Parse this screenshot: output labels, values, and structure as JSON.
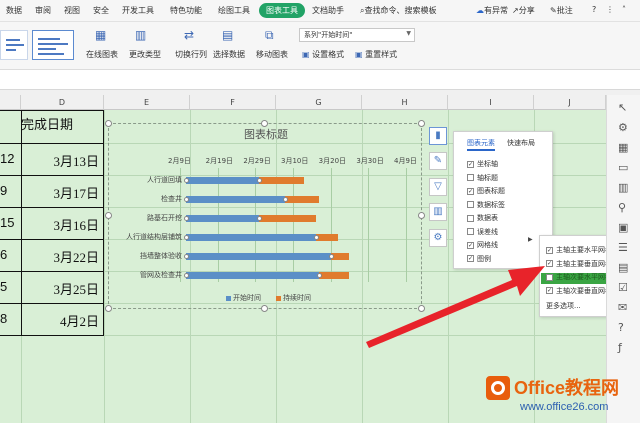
{
  "menu": {
    "items": [
      "数据",
      "审阅",
      "视图",
      "安全",
      "开发工具",
      "特色功能",
      "绘图工具",
      "图表工具",
      "文档助手"
    ],
    "active": "图表工具",
    "search": "查找命令、搜索模板",
    "right": [
      "有异常",
      "分享",
      "批注",
      "?"
    ]
  },
  "ribbon": {
    "online_chart": "在线图表",
    "change_type": "更改类型",
    "switch_row_col": "切换行列",
    "select_data": "选择数据",
    "move_chart": "移动图表",
    "series_select": "系列\"开始时间\"",
    "set_format": "设置格式",
    "reset_style": "重置样式"
  },
  "columns": [
    "D",
    "E",
    "F",
    "G",
    "H",
    "I",
    "J"
  ],
  "table": {
    "header": "完成日期",
    "rows": [
      {
        "c": "12",
        "d": "3月13日"
      },
      {
        "c": "9",
        "d": "3月17日"
      },
      {
        "c": "15",
        "d": "3月16日"
      },
      {
        "c": "6",
        "d": "3月22日"
      },
      {
        "c": "5",
        "d": "3月25日"
      },
      {
        "c": "8",
        "d": "4月2日"
      }
    ]
  },
  "chart_data": {
    "type": "bar",
    "title": "图表标题",
    "x_ticks": [
      "2月9日",
      "2月19日",
      "2月29日",
      "3月10日",
      "3月20日",
      "3月30日",
      "4月9日"
    ],
    "categories": [
      "人行道回填",
      "检查井",
      "路基石开挖",
      "人行道结构层铺筑",
      "挡墙整体验收",
      "管网及检查井"
    ],
    "series": [
      {
        "name": "开始时间",
        "color": "#5b8fc7",
        "values": [
          "3月1日",
          "3月8日",
          "3月1日",
          "3月16日",
          "3月20日",
          "3月17日"
        ]
      },
      {
        "name": "持续时间",
        "color": "#e07b2d",
        "values": [
          12,
          9,
          15,
          6,
          5,
          8
        ]
      }
    ],
    "grid": true,
    "legend": "bottom"
  },
  "panel": {
    "tabs": [
      "图表元素",
      "快速布局"
    ],
    "items": [
      {
        "label": "坐标轴",
        "checked": true
      },
      {
        "label": "轴标题",
        "checked": false
      },
      {
        "label": "图表标题",
        "checked": true
      },
      {
        "label": "数据标签",
        "checked": false
      },
      {
        "label": "数据表",
        "checked": false
      },
      {
        "label": "误差线",
        "checked": false
      },
      {
        "label": "网格线",
        "checked": true
      },
      {
        "label": "图例",
        "checked": true
      }
    ]
  },
  "submenu": {
    "items": [
      {
        "label": "主轴主要水平网格线",
        "checked": true
      },
      {
        "label": "主轴主要垂直网格线",
        "checked": true
      },
      {
        "label": "主轴次要水平网格线",
        "checked": false
      },
      {
        "label": "主轴次要垂直网格线",
        "checked": true
      }
    ],
    "more": "更多选项..."
  },
  "watermark": {
    "title": "Office教程网",
    "url": "www.office26.com"
  },
  "colors": {
    "accent": "#21a366",
    "sheet_bg": "#d9efd6",
    "arrow": "#e8232a",
    "highlight": "#3aa543"
  }
}
